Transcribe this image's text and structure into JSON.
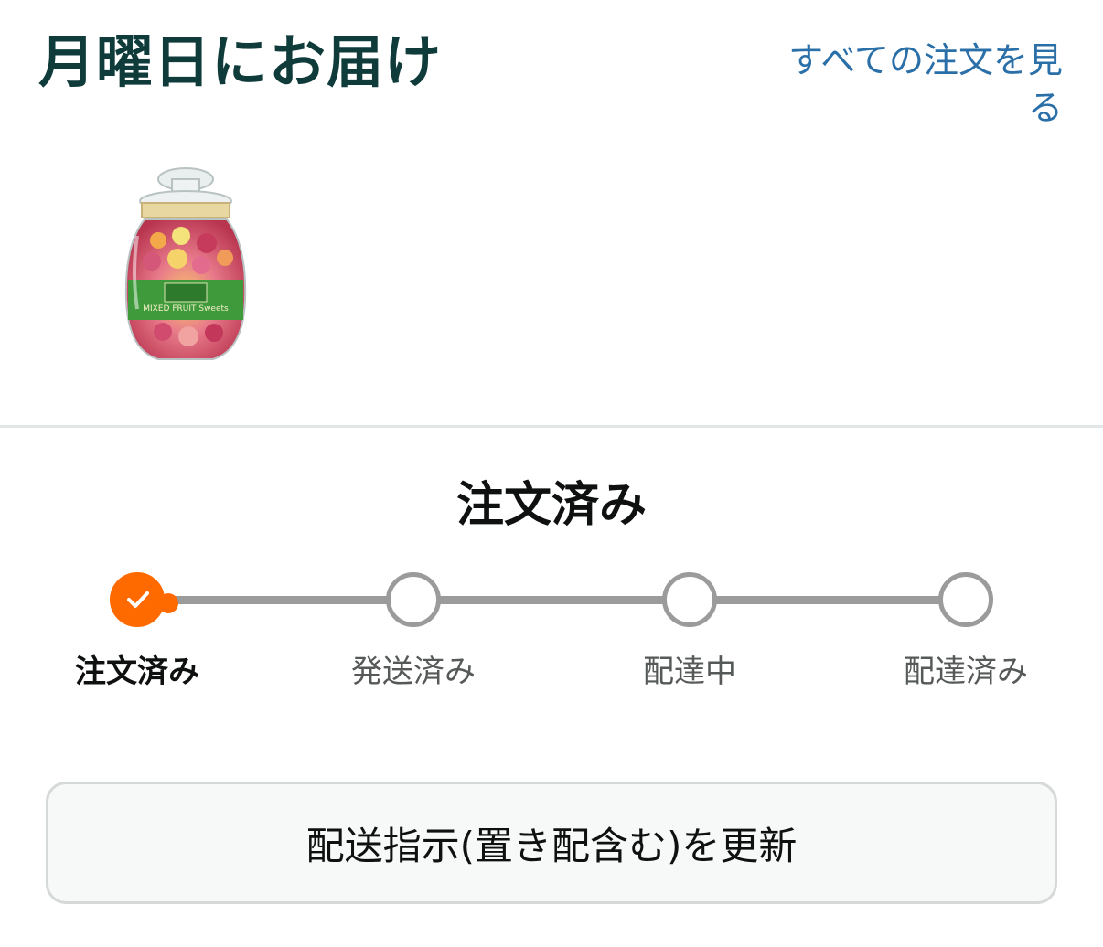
{
  "header": {
    "title": "月曜日にお届け",
    "view_all_link": "すべての注文を見る"
  },
  "product": {
    "image_label": "MIXED FRUIT Sweets"
  },
  "status": {
    "heading": "注文済み",
    "current_step_index": 0,
    "steps": [
      {
        "label": "注文済み",
        "state": "done"
      },
      {
        "label": "発送済み",
        "state": "pending"
      },
      {
        "label": "配達中",
        "state": "pending"
      },
      {
        "label": "配達済み",
        "state": "pending"
      }
    ]
  },
  "actions": {
    "update_button": "配送指示(置き配含む)を更新"
  },
  "colors": {
    "title": "#0f3b3b",
    "link": "#2a6fa8",
    "progress_done": "#ff6a00",
    "progress_pending": "#9b9b9b"
  },
  "icons": {
    "step_done": "check-icon"
  }
}
